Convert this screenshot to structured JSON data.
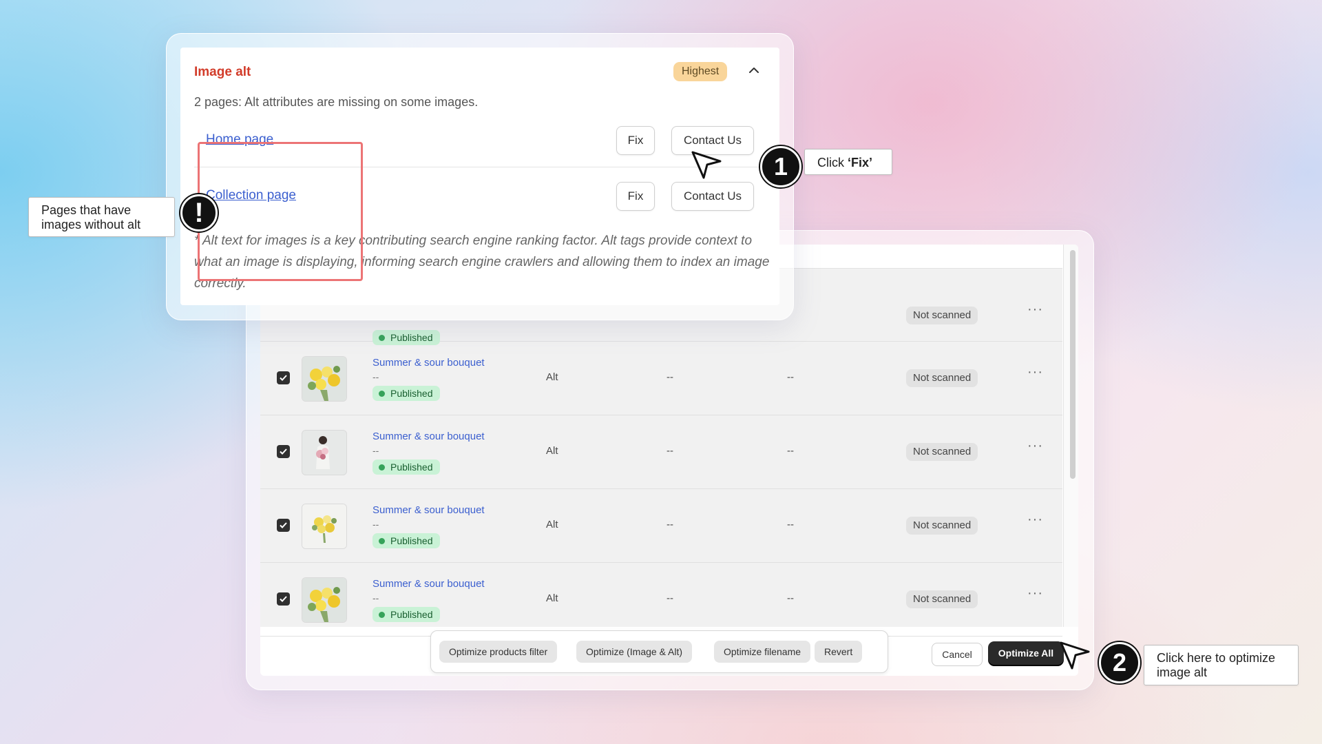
{
  "issue": {
    "title": "Image alt",
    "priority": "Highest",
    "description": "2 pages: Alt attributes are missing on some images.",
    "pages": [
      {
        "link": "Home page",
        "fix_label": "Fix",
        "contact_label": "Contact Us"
      },
      {
        "link": "Collection page",
        "fix_label": "Fix",
        "contact_label": "Contact Us"
      }
    ],
    "note": "* Alt text for images is a key contributing search engine ranking factor. Alt tags provide context to what an image is displaying, informing search engine crawlers and allowing them to index an image correctly."
  },
  "products": {
    "rows": [
      {
        "name": "",
        "sub": "",
        "status": "Published",
        "type": "",
        "col1": "",
        "col2": "",
        "scan": "Not scanned"
      },
      {
        "name": "Summer & sour bouquet",
        "sub": "--",
        "status": "Published",
        "type": "Alt",
        "col1": "--",
        "col2": "--",
        "scan": "Not scanned"
      },
      {
        "name": "Summer & sour bouquet",
        "sub": "--",
        "status": "Published",
        "type": "Alt",
        "col1": "--",
        "col2": "--",
        "scan": "Not scanned"
      },
      {
        "name": "Summer & sour bouquet",
        "sub": "--",
        "status": "Published",
        "type": "Alt",
        "col1": "--",
        "col2": "--",
        "scan": "Not scanned"
      },
      {
        "name": "Summer & sour bouquet",
        "sub": "--",
        "status": "Published",
        "type": "Alt",
        "col1": "--",
        "col2": "--",
        "scan": "Not scanned"
      }
    ],
    "actions": [
      "Optimize products filter",
      "Optimize (Image & Alt)",
      "Optimize filename",
      "Revert"
    ],
    "cancel_label": "Cancel",
    "optimize_all_label": "Optimize All"
  },
  "callouts": {
    "step1_number": "1",
    "step1_prefix": "Click ",
    "step1_bold": "‘Fix’",
    "warning_mark": "!",
    "warning_text": "Pages that have images without alt",
    "step2_number": "2",
    "step2_text": "Click here to optimize image alt"
  },
  "icons": [
    "checkbox-checked-icon",
    "chevron-up-icon",
    "more-horizontal-icon",
    "cursor-arrow-icon",
    "exclamation-icon"
  ],
  "colors": {
    "accent_red": "#d23c2a",
    "link_blue": "#3b5fcf",
    "priority_bg": "#f9d59a",
    "published_bg": "#c9f2d6",
    "highlight": "#ec7475"
  }
}
